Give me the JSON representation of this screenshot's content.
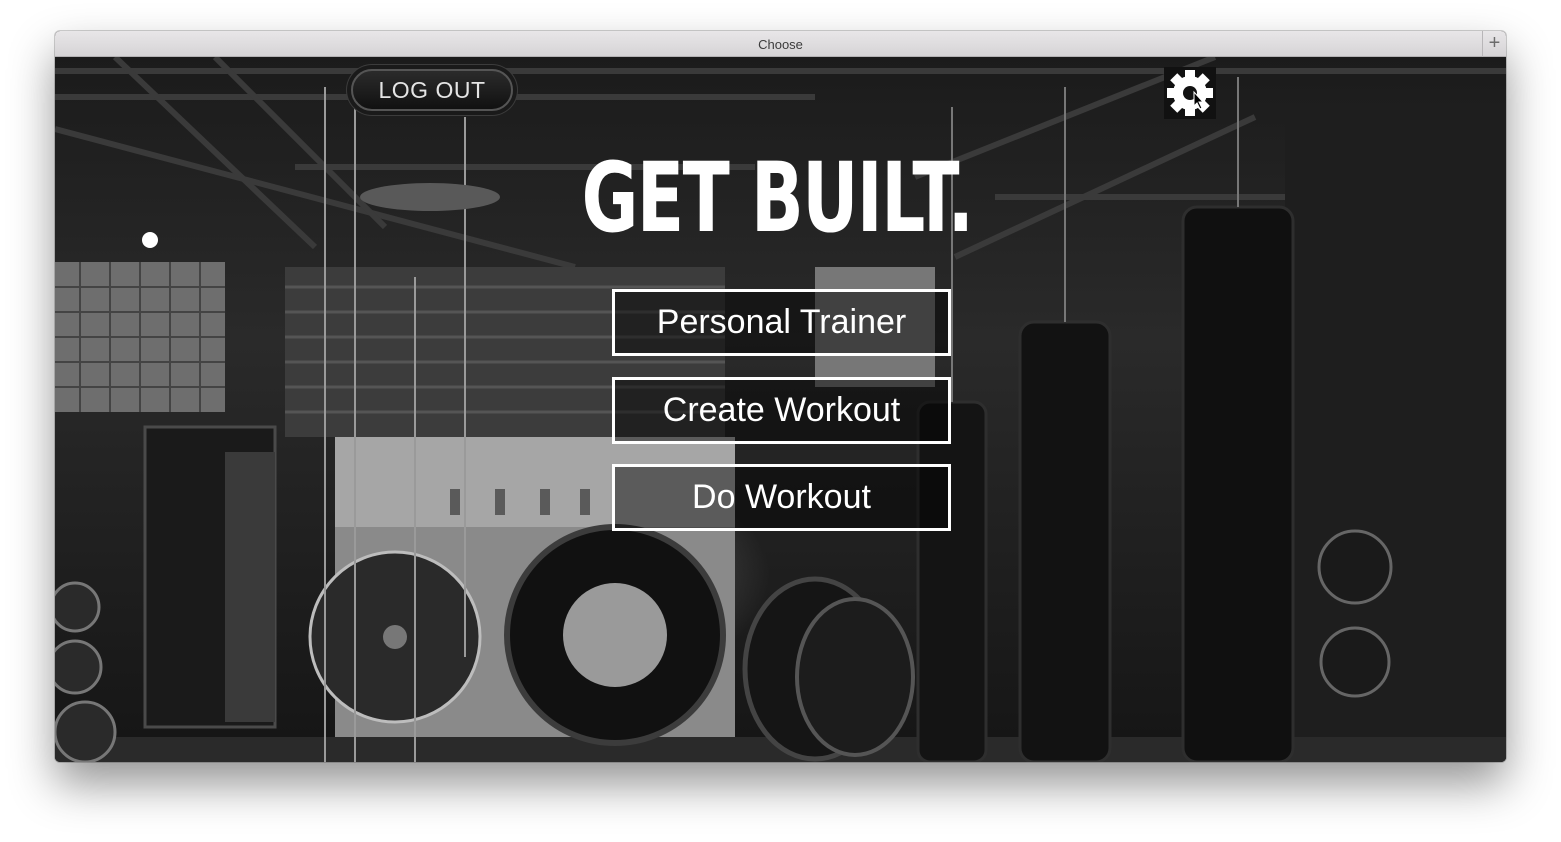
{
  "window": {
    "title": "Choose",
    "new_tab_label": "+"
  },
  "header": {
    "logout_label": "LOG OUT",
    "settings_icon": "gear-icon"
  },
  "main": {
    "title": "GET BUILT.",
    "buttons": [
      {
        "label": "Personal Trainer"
      },
      {
        "label": "Create Workout"
      },
      {
        "label": "Do Workout"
      }
    ]
  },
  "colors": {
    "background": "#1b1b1b",
    "text": "#ffffff",
    "button_border": "#ffffff"
  }
}
